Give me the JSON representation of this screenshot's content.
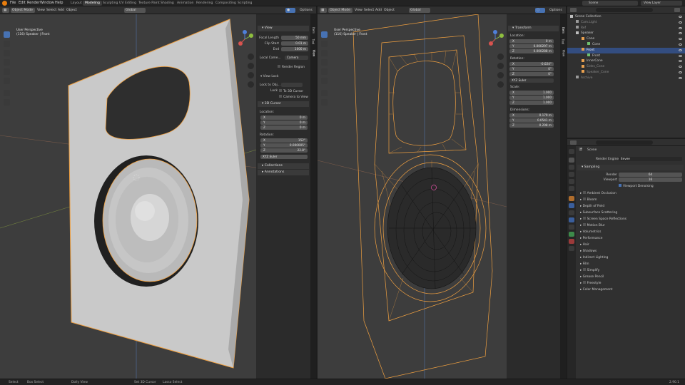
{
  "topmenu": [
    "File",
    "Edit",
    "Render",
    "Window",
    "Help"
  ],
  "workspaces": [
    "Layout",
    "Modeling",
    "Sculpting",
    "UV Editing",
    "Texture Paint",
    "Shading",
    "Animation",
    "Rendering",
    "Compositing",
    "Scripting"
  ],
  "active_workspace": "Modeling",
  "scene_name": "Scene",
  "view_layer": "View Layer",
  "left_vp": {
    "mode": "Object Mode",
    "menus": [
      "View",
      "Select",
      "Add",
      "Object"
    ],
    "orientation": "Global",
    "options": "Options",
    "perspective": "User Perspective",
    "object_info": "(116) Speaker | Front",
    "npanel": {
      "tabs": [
        "Item",
        "Tool",
        "View"
      ],
      "view_header": "View",
      "focal_length_label": "Focal Length",
      "focal_length": "50 mm",
      "clip_start_label": "Clip Start",
      "clip_start": "0.01 m",
      "end_label": "End",
      "end": "1000 m",
      "local_camera_label": "Local Came...",
      "local_camera_value": "Camera",
      "render_region": "Render Region",
      "view_lock_header": "View Lock",
      "lock_to_obj_label": "Lock to Obj...",
      "lock_label": "Lock",
      "to_3d_cursor": "To 3D Cursor",
      "camera_to_view": "Camera to View",
      "cursor_header": "3D Cursor",
      "location_label": "Location:",
      "loc": [
        {
          "axis": "X",
          "value": "0 m"
        },
        {
          "axis": "Y",
          "value": "0 m"
        },
        {
          "axis": "Z",
          "value": "0 m"
        }
      ],
      "rotation_label": "Rotation:",
      "rot": [
        {
          "axis": "X",
          "value": "152°"
        },
        {
          "axis": "Y",
          "value": "0.000005°"
        },
        {
          "axis": "Z",
          "value": "22.8°"
        }
      ],
      "rot_mode": "XYZ Euler",
      "collections": "Collections",
      "annotations": "Annotations"
    }
  },
  "right_vp": {
    "mode": "Object Mode",
    "menus": [
      "View",
      "Select",
      "Add",
      "Object"
    ],
    "orientation": "Global",
    "options": "Options",
    "perspective": "User Perspective",
    "object_info": "(116) Speaker | Front",
    "npanel": {
      "tabs": [
        "Item",
        "Tool",
        "View"
      ],
      "transform_header": "Transform",
      "location_label": "Location:",
      "loc": [
        {
          "axis": "X",
          "value": "0 m"
        },
        {
          "axis": "Y",
          "value": "0.000297 m"
        },
        {
          "axis": "Z",
          "value": "0.000288 m"
        }
      ],
      "rotation_label": "Rotation:",
      "rot": [
        {
          "axis": "X",
          "value": "-0.024°"
        },
        {
          "axis": "Y",
          "value": "0°"
        },
        {
          "axis": "Z",
          "value": "0°"
        }
      ],
      "rot_mode": "XYZ Euler",
      "scale_label": "Scale:",
      "scale": [
        {
          "axis": "X",
          "value": "1.000"
        },
        {
          "axis": "Y",
          "value": "1.000"
        },
        {
          "axis": "Z",
          "value": "1.000"
        }
      ],
      "dimensions_label": "Dimensions:",
      "dims": [
        {
          "axis": "X",
          "value": "0.179 m"
        },
        {
          "axis": "Y",
          "value": "0.0541 m"
        },
        {
          "axis": "Z",
          "value": "0.298 m"
        }
      ]
    }
  },
  "outliner": {
    "items": [
      {
        "label": "Scene Collection",
        "indent": 0,
        "icon": "#bdbdbd"
      },
      {
        "label": "Cam.Light",
        "indent": 1,
        "icon": "#9a9a9a",
        "dim": true
      },
      {
        "label": "Ref",
        "indent": 1,
        "icon": "#9a9a9a",
        "dim": true
      },
      {
        "label": "Speaker",
        "indent": 1,
        "icon": "#bdbdbd"
      },
      {
        "label": "Cone",
        "indent": 2,
        "icon": "#e8a04f"
      },
      {
        "label": "Cone",
        "indent": 3,
        "icon": "#6fbf6f"
      },
      {
        "label": "Front",
        "indent": 2,
        "icon": "#e8a04f",
        "sel": true
      },
      {
        "label": "Front",
        "indent": 3,
        "icon": "#6fbf6f"
      },
      {
        "label": "InnerCone",
        "indent": 2,
        "icon": "#e8a04f"
      },
      {
        "label": "Sides_Cone",
        "indent": 2,
        "icon": "#e8a04f",
        "dim": true
      },
      {
        "label": "Speaker_Cone",
        "indent": 2,
        "icon": "#e8a04f",
        "dim": true
      },
      {
        "label": "Archive",
        "indent": 1,
        "icon": "#9a9a9a",
        "dim": true
      }
    ]
  },
  "properties": {
    "scene": "Scene",
    "render_engine_label": "Render Engine",
    "render_engine": "Eevee",
    "sampling": "Sampling",
    "render_label": "Render",
    "render_val": "64",
    "viewport_label": "Viewport",
    "viewport_val": "16",
    "viewport_denoising": "Viewport Denoising",
    "panels": [
      {
        "label": "Ambient Occlusion",
        "check": true
      },
      {
        "label": "Bloom",
        "check": true
      },
      {
        "label": "Depth of Field",
        "check": false
      },
      {
        "label": "Subsurface Scattering",
        "check": false
      },
      {
        "label": "Screen Space Reflections",
        "check": true
      },
      {
        "label": "Motion Blur",
        "check": true
      },
      {
        "label": "Volumetrics",
        "check": false
      },
      {
        "label": "Performance",
        "check": false
      },
      {
        "label": "Hair",
        "check": false
      },
      {
        "label": "Shadows",
        "check": false
      },
      {
        "label": "Indirect Lighting",
        "check": false
      },
      {
        "label": "Film",
        "check": false
      },
      {
        "label": "Simplify",
        "check": true
      },
      {
        "label": "Grease Pencil",
        "check": false
      },
      {
        "label": "Freestyle",
        "check": true
      },
      {
        "label": "Color Management",
        "check": false
      }
    ]
  },
  "statusbar": {
    "items": [
      "Select",
      "Box Select",
      "Dolly View",
      "Set 3D Cursor",
      "Lasso Select"
    ],
    "version": "2.90.1"
  },
  "colors": {
    "accent": "#4772b3",
    "selection_orange": "#f0a040",
    "viewport_bg": "#3d3d3d"
  }
}
